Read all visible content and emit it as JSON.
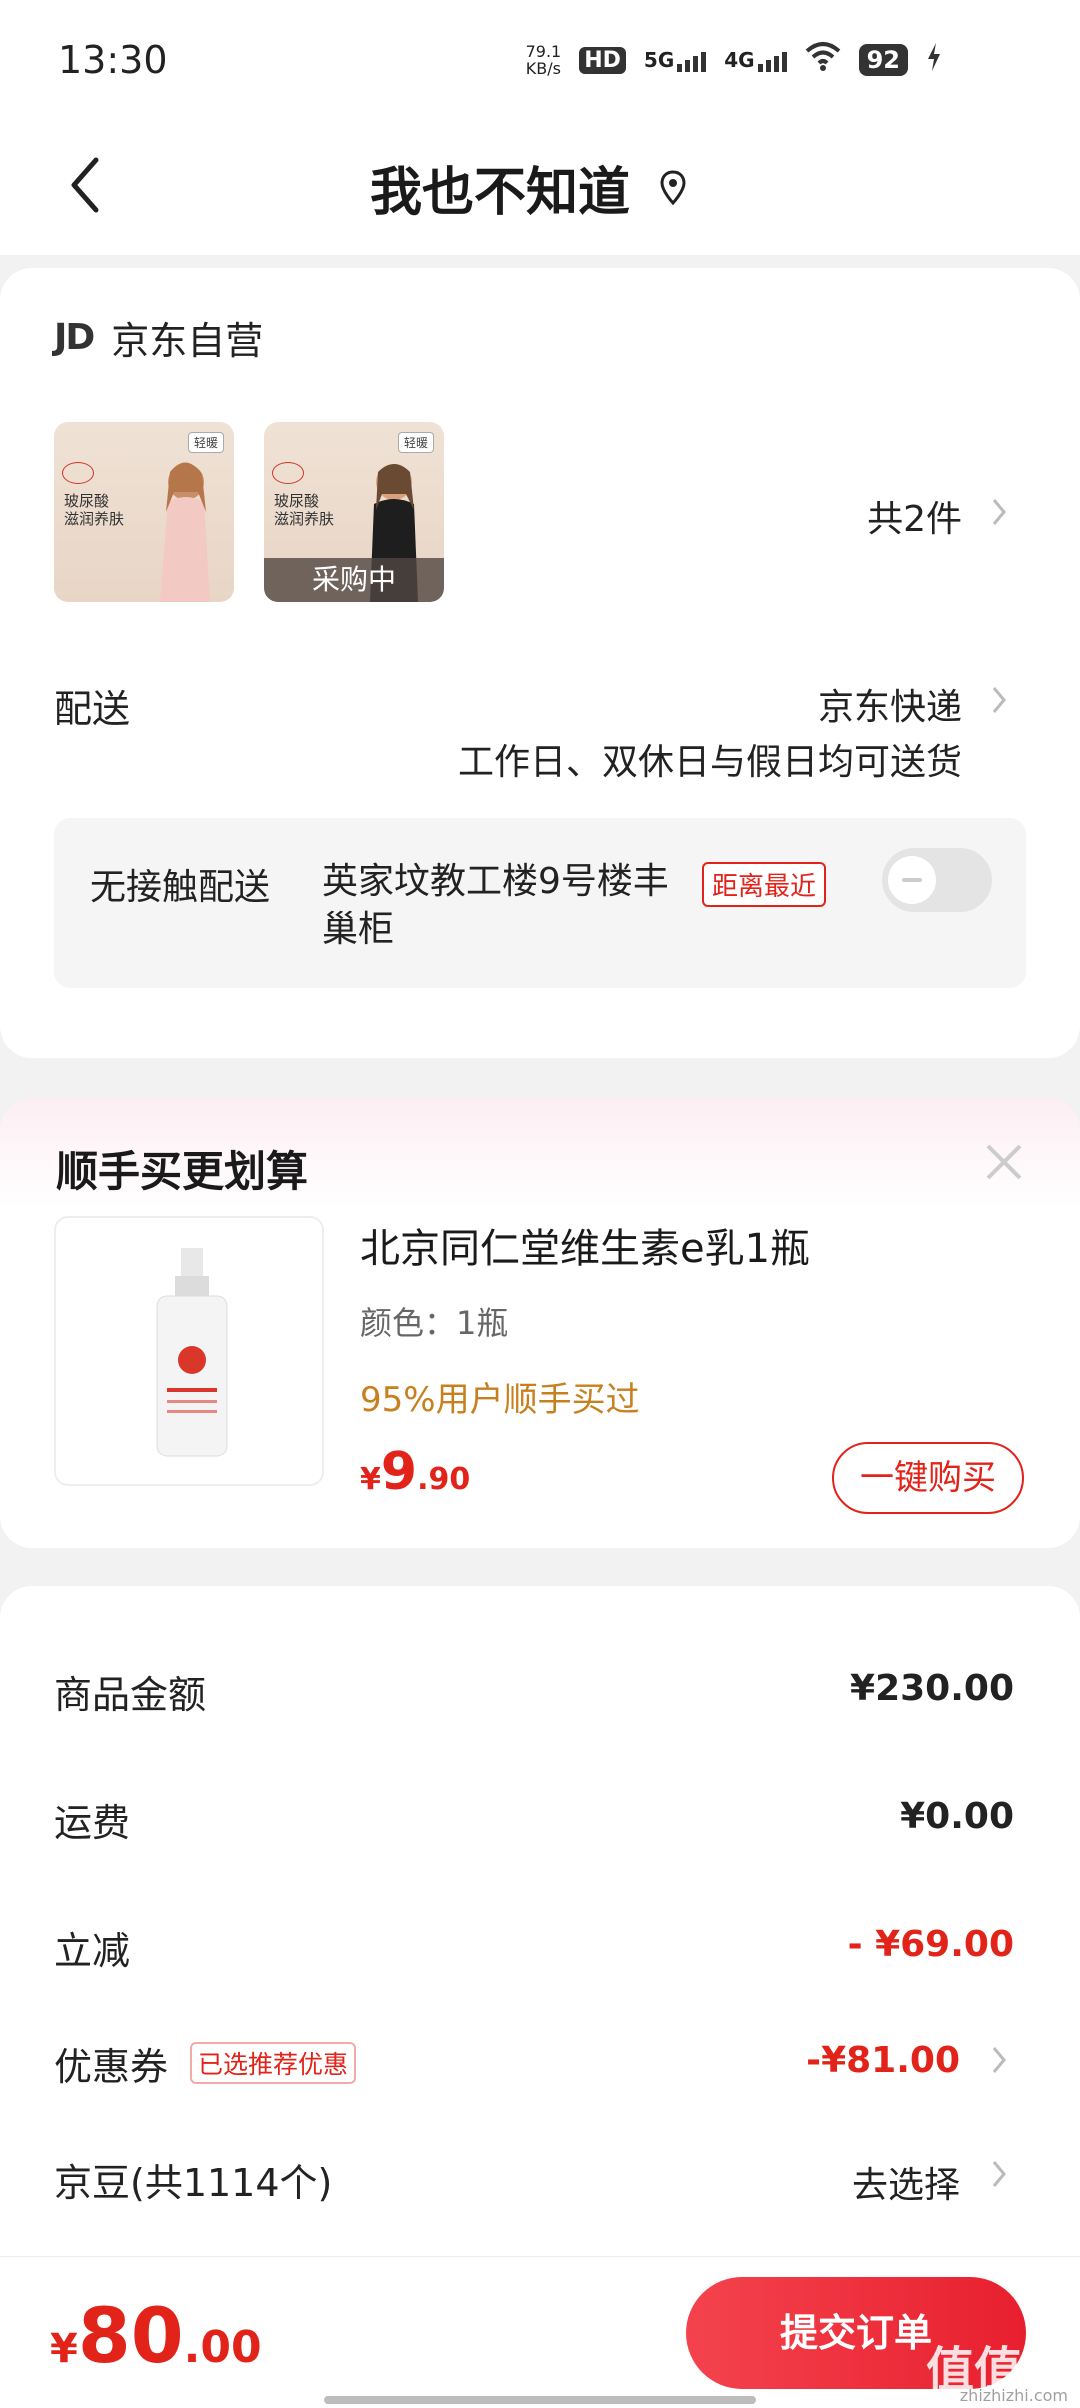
{
  "status_bar": {
    "time": "13:30",
    "net_speed_value": "79.1",
    "net_speed_unit": "KB/s",
    "hd_label": "HD",
    "sim1_label": "5G",
    "sim2_label": "4G",
    "battery": "92"
  },
  "header": {
    "title": "我也不知道"
  },
  "order_card": {
    "store_logo": "JD",
    "store_name": "京东自营",
    "product_thumbs": [
      {
        "tag": "轻暖",
        "text": "玻尿酸\n滋润养肤"
      },
      {
        "tag": "轻暖",
        "text": "玻尿酸\n滋润养肤",
        "overlay": "采购中"
      }
    ],
    "item_count": "共2件",
    "delivery_label": "配送",
    "carrier": "京东快递",
    "delivery_note": "工作日、双休日与假日均可送货",
    "contactless_label": "无接触配送",
    "contactless_address": "英家坟教工楼9号楼丰巢柜",
    "contactless_tag": "距离最近"
  },
  "upsell": {
    "title": "顺手买更划算",
    "product_name": "北京同仁堂维生素e乳1瓶",
    "spec": "颜色：1瓶",
    "stat": "95%用户顺手买过",
    "price_yen": "¥",
    "price_int": "9",
    "price_dec": ".90",
    "buy_label": "一键购买"
  },
  "summary": {
    "rows": [
      {
        "label": "商品金额",
        "value": "¥230.00"
      },
      {
        "label": "运费",
        "value": "¥0.00"
      },
      {
        "label": "立减",
        "value": "- ¥69.00"
      },
      {
        "label": "优惠券",
        "tag": "已选推荐优惠",
        "value": "-¥81.00"
      },
      {
        "label": "京豆(共1114个)",
        "value": "去选择"
      }
    ]
  },
  "bottom_bar": {
    "total_yen": "¥",
    "total_int": "80",
    "total_dec": ".00",
    "submit_label": "提交订单"
  },
  "watermark": {
    "text": "值值值",
    "sub": "zhizhizhi.com"
  },
  "colors": {
    "accent": "#e2231a",
    "stat": "#c8801e",
    "background": "#f2f2f2"
  }
}
